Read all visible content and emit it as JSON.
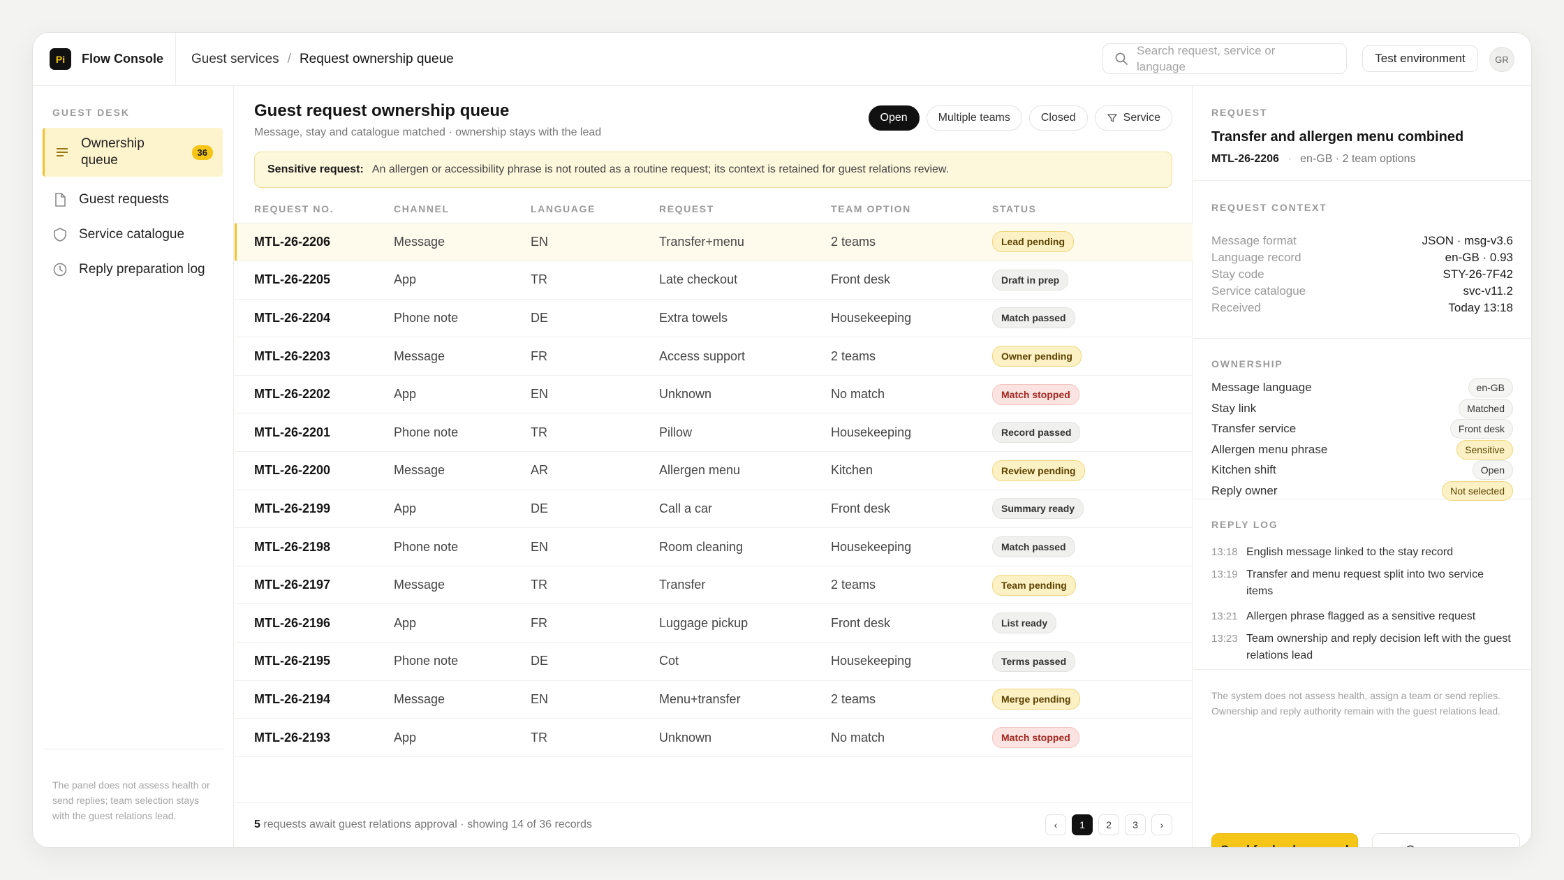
{
  "app": {
    "logo": "Pi",
    "name": "Flow Console"
  },
  "breadcrumb": {
    "parent": "Guest services",
    "separator": "/",
    "current": "Request ownership queue"
  },
  "search": {
    "placeholder": "Search request, service or language"
  },
  "header": {
    "environment_label": "Test environment",
    "avatar_initials": "GR"
  },
  "sidebar": {
    "heading": "GUEST DESK",
    "items": [
      {
        "label": "Ownership queue",
        "badge": "36",
        "icon": "list-icon",
        "active": true
      },
      {
        "label": "Guest requests",
        "icon": "document-icon"
      },
      {
        "label": "Service catalogue",
        "icon": "shield-icon"
      },
      {
        "label": "Reply preparation log",
        "icon": "clock-icon"
      }
    ],
    "footer": "The panel does not assess health or send replies; team selection stays with the guest relations lead."
  },
  "main": {
    "title": "Guest request ownership queue",
    "subtitle": "Message, stay and catalogue matched · ownership stays with the lead",
    "filters": [
      {
        "label": "Open",
        "active": true
      },
      {
        "label": "Multiple teams"
      },
      {
        "label": "Closed"
      },
      {
        "label": "Service",
        "icon": "filter-icon"
      }
    ],
    "alert": {
      "title": "Sensitive request:",
      "text": "An allergen or accessibility phrase is not routed as a routine request; its context is retained for guest relations review."
    },
    "columns": [
      "REQUEST NO.",
      "CHANNEL",
      "LANGUAGE",
      "REQUEST",
      "TEAM OPTION",
      "STATUS"
    ],
    "rows": [
      {
        "id": "MTL-26-2206",
        "channel": "Message",
        "language": "EN",
        "request": "Transfer+menu",
        "team": "2 teams",
        "status": "Lead pending",
        "tone": "yellow",
        "selected": true
      },
      {
        "id": "MTL-26-2205",
        "channel": "App",
        "language": "TR",
        "request": "Late checkout",
        "team": "Front desk",
        "status": "Draft in prep",
        "tone": "neutral"
      },
      {
        "id": "MTL-26-2204",
        "channel": "Phone note",
        "language": "DE",
        "request": "Extra towels",
        "team": "Housekeeping",
        "status": "Match passed",
        "tone": "neutral"
      },
      {
        "id": "MTL-26-2203",
        "channel": "Message",
        "language": "FR",
        "request": "Access support",
        "team": "2 teams",
        "status": "Owner pending",
        "tone": "yellow"
      },
      {
        "id": "MTL-26-2202",
        "channel": "App",
        "language": "EN",
        "request": "Unknown",
        "team": "No match",
        "status": "Match stopped",
        "tone": "red"
      },
      {
        "id": "MTL-26-2201",
        "channel": "Phone note",
        "language": "TR",
        "request": "Pillow",
        "team": "Housekeeping",
        "status": "Record passed",
        "tone": "neutral"
      },
      {
        "id": "MTL-26-2200",
        "channel": "Message",
        "language": "AR",
        "request": "Allergen menu",
        "team": "Kitchen",
        "status": "Review pending",
        "tone": "yellow"
      },
      {
        "id": "MTL-26-2199",
        "channel": "App",
        "language": "DE",
        "request": "Call a car",
        "team": "Front desk",
        "status": "Summary ready",
        "tone": "neutral"
      },
      {
        "id": "MTL-26-2198",
        "channel": "Phone note",
        "language": "EN",
        "request": "Room cleaning",
        "team": "Housekeeping",
        "status": "Match passed",
        "tone": "neutral"
      },
      {
        "id": "MTL-26-2197",
        "channel": "Message",
        "language": "TR",
        "request": "Transfer",
        "team": "2 teams",
        "status": "Team pending",
        "tone": "yellow"
      },
      {
        "id": "MTL-26-2196",
        "channel": "App",
        "language": "FR",
        "request": "Luggage pickup",
        "team": "Front desk",
        "status": "List ready",
        "tone": "neutral"
      },
      {
        "id": "MTL-26-2195",
        "channel": "Phone note",
        "language": "DE",
        "request": "Cot",
        "team": "Housekeeping",
        "status": "Terms passed",
        "tone": "neutral"
      },
      {
        "id": "MTL-26-2194",
        "channel": "Message",
        "language": "EN",
        "request": "Menu+transfer",
        "team": "2 teams",
        "status": "Merge pending",
        "tone": "yellow"
      },
      {
        "id": "MTL-26-2193",
        "channel": "App",
        "language": "TR",
        "request": "Unknown",
        "team": "No match",
        "status": "Match stopped",
        "tone": "red"
      }
    ],
    "footer": {
      "count": "5",
      "text": "requests await guest relations approval · showing 14 of 36 records"
    },
    "pager": {
      "prev": "‹",
      "pages": [
        "1",
        "2",
        "3"
      ],
      "next": "›",
      "current": "1"
    }
  },
  "panel": {
    "label": "REQUEST",
    "title": "Transfer and allergen menu combined",
    "id": "MTL-26-2206",
    "meta": "en-GB · 2 team options",
    "context_label": "REQUEST CONTEXT",
    "context": [
      {
        "k": "Message format",
        "v": "JSON · msg-v3.6"
      },
      {
        "k": "Language record",
        "v": "en-GB · 0.93"
      },
      {
        "k": "Stay code",
        "v": "STY-26-7F42"
      },
      {
        "k": "Service catalogue",
        "v": "svc-v11.2"
      },
      {
        "k": "Received",
        "v": "Today 13:18"
      }
    ],
    "ownership_label": "OWNERSHIP",
    "ownership": [
      {
        "k": "Message language",
        "v": "en-GB",
        "tone": "neutral"
      },
      {
        "k": "Stay link",
        "v": "Matched",
        "tone": "neutral"
      },
      {
        "k": "Transfer service",
        "v": "Front desk",
        "tone": "neutral"
      },
      {
        "k": "Allergen menu phrase",
        "v": "Sensitive",
        "tone": "yellow"
      },
      {
        "k": "Kitchen shift",
        "v": "Open",
        "tone": "neutral"
      },
      {
        "k": "Reply owner",
        "v": "Not selected",
        "tone": "yellow"
      }
    ],
    "log_label": "REPLY LOG",
    "log": [
      {
        "t": "13:18",
        "text": "English message linked to the stay record"
      },
      {
        "t": "13:19",
        "text": "Transfer and menu request split into two service items"
      },
      {
        "t": "13:21",
        "text": "Allergen phrase flagged as a sensitive request"
      },
      {
        "t": "13:23",
        "text": "Team ownership and reply decision left with the guest relations lead"
      }
    ],
    "note": "The system does not assess health, assign a team or send replies. Ownership and reply authority remain with the guest relations lead.",
    "primary_button": "Send for lead approval",
    "secondary_button": "Open message"
  }
}
